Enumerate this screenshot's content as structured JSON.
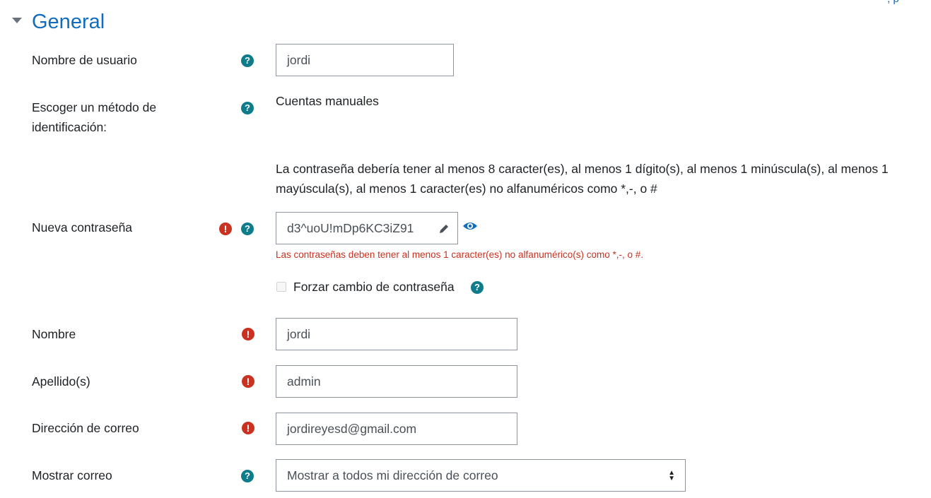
{
  "section": {
    "title": "General",
    "corner_link": ", p"
  },
  "fields": {
    "username": {
      "label": "Nombre de usuario",
      "value": "jordi"
    },
    "auth": {
      "label_line1": "Escoger un método de",
      "label_line2": "identificación:",
      "value": "Cuentas manuales"
    },
    "policy": {
      "line1": "La contraseña debería tener al menos 8 caracter(es), al menos 1 dígito(s), al menos 1 minúscula(s), al menos 1",
      "line2": "mayúscula(s), al menos 1 caracter(es) no alfanuméricos como *,-, o #"
    },
    "new_password": {
      "label": "Nueva contraseña",
      "value": "d3^uoU!mDp6KC3iZ91",
      "error": "Las contraseñas deben tener al menos 1 caracter(es) no alfanumérico(s) como *,-, o #."
    },
    "force_change": {
      "label": "Forzar cambio de contraseña",
      "checked": false
    },
    "firstname": {
      "label": "Nombre",
      "value": "jordi"
    },
    "lastname": {
      "label": "Apellido(s)",
      "value": "admin"
    },
    "email": {
      "label": "Dirección de correo",
      "value": "jordireyesd@gmail.com"
    },
    "maildisplay": {
      "label": "Mostrar correo",
      "selected": "Mostrar a todos mi dirección de correo"
    }
  },
  "icons": {
    "help": "question-circle-icon",
    "required": "exclamation-circle-icon",
    "edit": "pencil-icon",
    "reveal": "eye-icon",
    "collapse": "caret-down-icon"
  },
  "colors": {
    "accent": "#0f6cbf",
    "help": "#0f7c8c",
    "error": "#ca3120"
  }
}
